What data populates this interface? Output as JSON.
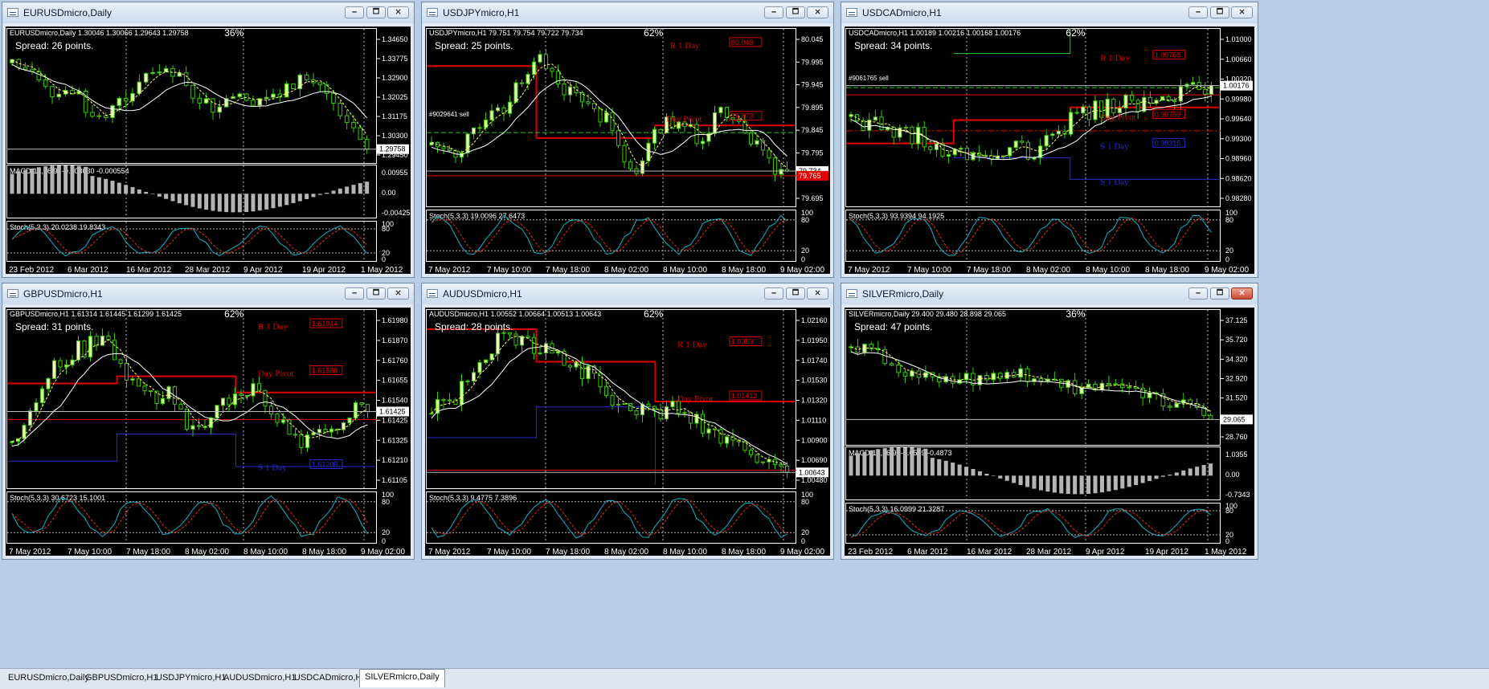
{
  "windows": [
    {
      "title": "EURUSDmicro,Daily",
      "info": "EURUSDmicro,Daily  1.30046 1.30066 1.29643 1.29758",
      "percent": "36%",
      "spread": "Spread: 26 points.",
      "price_ticks": [
        "1.34650",
        "1.33775",
        "1.32900",
        "1.32025",
        "1.31175",
        "1.30300",
        "1.29450"
      ],
      "current_price": "1.29758",
      "indicator1": "MACD(12,26,9) -0.003630 -0.000554",
      "indicator1_ticks": [
        "0.00955",
        "0.00",
        "-0.00425"
      ],
      "stoch": "Stoch(5,3,3) 20.0238 19.8343",
      "stoch_ticks": [
        "100",
        "80",
        "20",
        "0"
      ],
      "time_ticks": [
        "23 Feb 2012",
        "6 Mar 2012",
        "16 Mar 2012",
        "28 Mar 2012",
        "9 Apr 2012",
        "19 Apr 2012",
        "1 May 2012"
      ],
      "pivot_labels": []
    },
    {
      "title": "USDJPYmicro,H1",
      "info": "USDJPYmicro,H1  79.751 79.754 79.722 79.734",
      "percent": "62%",
      "spread": "Spread: 25 points.",
      "order_label": "#9029641 sell",
      "price_ticks": [
        "80.045",
        "79.995",
        "79.945",
        "79.895",
        "79.845",
        "79.795",
        "79.745",
        "79.695"
      ],
      "current_price": "79.734",
      "red_price": "79.765",
      "indicator1": "",
      "indicator1_ticks": [],
      "stoch": "Stoch(5,3,3) 19.0096 27.6473",
      "stoch_ticks": [
        "100",
        "80",
        "20",
        "0"
      ],
      "time_ticks": [
        "7 May 2012",
        "7 May 10:00",
        "7 May 18:00",
        "8 May 02:00",
        "8 May 10:00",
        "8 May 18:00",
        "9 May 02:00"
      ],
      "pivot_labels": [
        "R 1 Day",
        "Day Pivot"
      ],
      "pivot_values": [
        "80.048",
        "79.873"
      ]
    },
    {
      "title": "USDCADmicro,H1",
      "info": "USDCADmicro,H1  1.00189 1.00216 1.00168 1.00176",
      "percent": "62%",
      "spread": "Spread: 34 points.",
      "order_label": "#9061765 sell",
      "price_ticks": [
        "1.01000",
        "1.00660",
        "1.00320",
        "0.99980",
        "0.99640",
        "0.99300",
        "0.98960",
        "0.98620",
        "0.98280"
      ],
      "current_price": "1.00176",
      "indicator1": "",
      "indicator1_ticks": [],
      "stoch": "Stoch(5,3,3) 93.9394 94.1925",
      "stoch_ticks": [
        "100",
        "80",
        "20",
        "0"
      ],
      "time_ticks": [
        "7 May 2012",
        "7 May 10:00",
        "7 May 18:00",
        "8 May 02:00",
        "8 May 10:00",
        "8 May 18:00",
        "9 May 02:00"
      ],
      "pivot_labels": [
        "R 1 Day",
        "Day Pivot",
        "S 1 Day",
        "S 1 Day"
      ],
      "pivot_values": [
        "1.00768",
        "0.99759",
        "0.98315"
      ]
    },
    {
      "title": "GBPUSDmicro,H1",
      "info": "GBPUSDmicro,H1  1.61314 1.61445 1.61299 1.61425",
      "percent": "62%",
      "spread": "Spread: 31 points.",
      "price_ticks": [
        "1.61980",
        "1.61870",
        "1.61760",
        "1.61655",
        "1.61540",
        "1.61425",
        "1.61325",
        "1.61210",
        "1.61105"
      ],
      "current_price": "1.61425",
      "indicator1": "",
      "indicator1_ticks": [],
      "stoch": "Stoch(5,3,3) 30.6723 15.1001",
      "stoch_ticks": [
        "100",
        "80",
        "20",
        "0"
      ],
      "time_ticks": [
        "7 May 2012",
        "7 May 10:00",
        "7 May 18:00",
        "8 May 02:00",
        "8 May 10:00",
        "8 May 18:00",
        "9 May 02:00"
      ],
      "pivot_labels": [
        "R 1 Day",
        "Day Pivot",
        "S 1 Day"
      ],
      "pivot_values": [
        "1.61944",
        "1.61588",
        "1.61208"
      ]
    },
    {
      "title": "AUDUSDmicro,H1",
      "info": "AUDUSDmicro,H1  1.00552 1.00664 1.00513 1.00643",
      "percent": "62%",
      "spread": "Spread: 28 points.",
      "price_ticks": [
        "1.02160",
        "1.01950",
        "1.01740",
        "1.01530",
        "1.01320",
        "1.01110",
        "1.00900",
        "1.00690",
        "1.00480"
      ],
      "current_price": "1.00643",
      "indicator1": "",
      "indicator1_ticks": [],
      "stoch": "Stoch(5,3,3) 9.4775 7.3896",
      "stoch_ticks": [
        "100",
        "80",
        "20",
        "0"
      ],
      "time_ticks": [
        "7 May 2012",
        "7 May 10:00",
        "7 May 18:00",
        "8 May 02:00",
        "8 May 10:00",
        "8 May 18:00",
        "9 May 02:00"
      ],
      "pivot_labels": [
        "R 1 Day",
        "Day Pivot"
      ],
      "pivot_values": [
        "1.0353",
        "1.01413"
      ]
    },
    {
      "title": "SILVERmicro,Daily",
      "info": "SILVERmicro,Daily  29.400 29.480 28.898 29.065",
      "percent": "36%",
      "spread": "Spread: 47 points.",
      "price_ticks": [
        "37.125",
        "35.720",
        "34.320",
        "32.920",
        "31.520",
        "30.160",
        "28.760"
      ],
      "current_price": "29.065",
      "indicator1": "MACD(12,26,9) -0.6539 -0.4873",
      "indicator1_ticks": [
        "1.0355",
        "0.00",
        "-0.7343"
      ],
      "stoch": "Stoch(5,3,3) 16.0999 21.3287",
      "stoch_ticks": [
        "100",
        "80",
        "20",
        "0"
      ],
      "time_ticks": [
        "23 Feb 2012",
        "6 Mar 2012",
        "16 Mar 2012",
        "28 Mar 2012",
        "9 Apr 2012",
        "19 Apr 2012",
        "1 May 2012"
      ],
      "pivot_labels": []
    }
  ],
  "window_buttons": {
    "minimize": "🗕",
    "maximize": "🗖",
    "close": "🗙"
  },
  "taskbar": {
    "tabs": [
      "EURUSDmicro,Daily",
      "GBPUSDmicro,H1",
      "USDJPYmicro,H1",
      "AUDUSDmicro,H1",
      "USDCADmicro,H1",
      "SILVERmicro,Daily"
    ],
    "selected": "SILVERmicro,Daily"
  },
  "colors": {
    "background": "#000000",
    "candle_up": "#e6ffb8",
    "candle_down": "#000000",
    "candle_outline": "#39c900",
    "ma": "#ffffff",
    "ma_dashed": "#ffff66",
    "stoch_main": "#11b3c4",
    "stoch_signal": "#e0301e",
    "macd": "#b5b5b5",
    "pivot": "#e00000",
    "support": "#2a2ad0",
    "grid": "#bbbbbb"
  }
}
